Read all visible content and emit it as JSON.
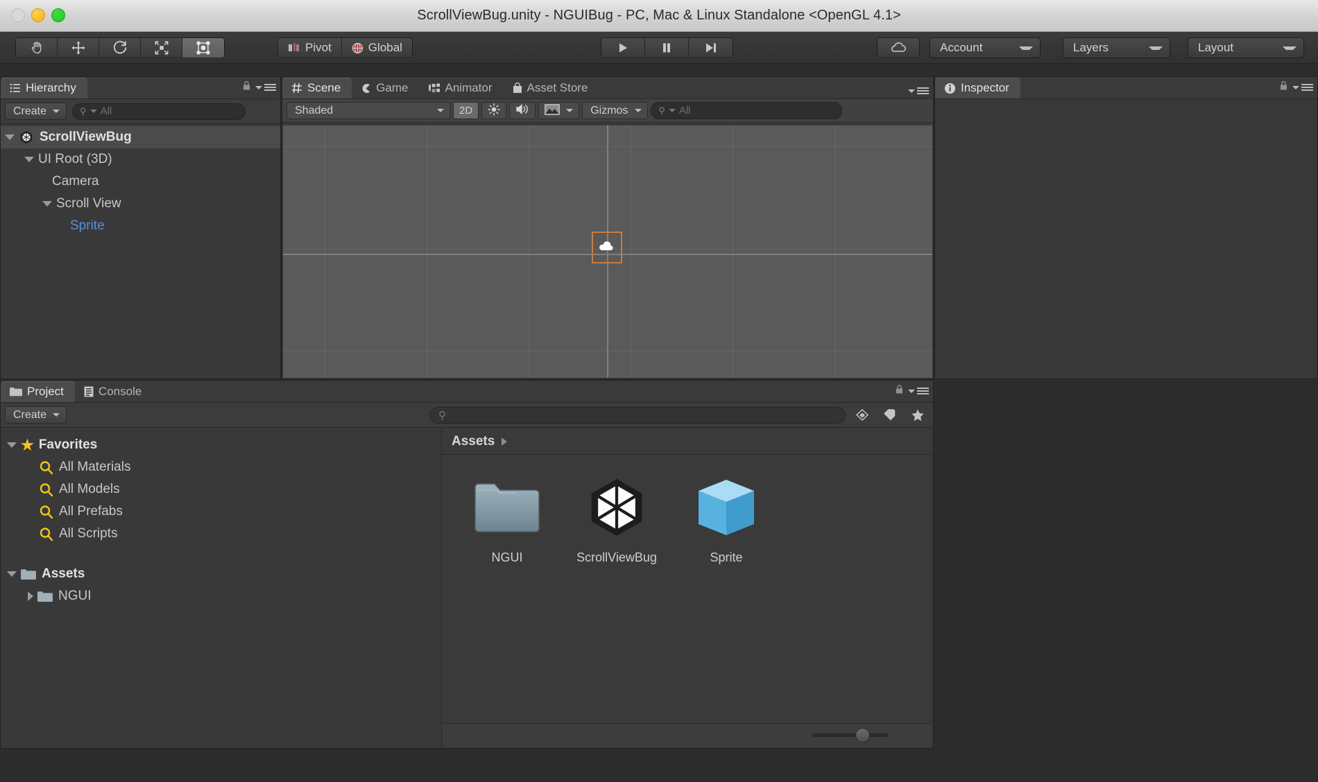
{
  "window": {
    "title": "ScrollViewBug.unity - NGUIBug - PC, Mac & Linux Standalone <OpenGL 4.1>",
    "traffic_lights": [
      "close-button",
      "minimize-button",
      "zoom-button"
    ]
  },
  "toolbar": {
    "transform_tools": [
      {
        "name": "hand-tool",
        "selected": false
      },
      {
        "name": "move-tool",
        "selected": false
      },
      {
        "name": "rotate-tool",
        "selected": false
      },
      {
        "name": "scale-tool",
        "selected": false
      },
      {
        "name": "rect-tool",
        "selected": true
      }
    ],
    "pivot_label": "Pivot",
    "global_label": "Global",
    "play_label": "",
    "pause_label": "",
    "step_label": "",
    "cloud_label": "",
    "account_label": "Account",
    "layers_label": "Layers",
    "layout_label": "Layout"
  },
  "hierarchy": {
    "tab_label": "Hierarchy",
    "create_label": "Create",
    "search_placeholder": "All",
    "items": [
      {
        "label": "ScrollViewBug",
        "depth": 0,
        "arrow": "down",
        "icon": "unity-logo-icon",
        "style": "root",
        "selected": true
      },
      {
        "label": "UI Root (3D)",
        "depth": 1,
        "arrow": "down",
        "icon": "",
        "style": "normal",
        "selected": false
      },
      {
        "label": "Camera",
        "depth": 2,
        "arrow": "none",
        "icon": "",
        "style": "normal",
        "selected": false
      },
      {
        "label": "Scroll View",
        "depth": 2,
        "arrow": "down",
        "icon": "",
        "style": "normal",
        "selected": false
      },
      {
        "label": "Sprite",
        "depth": 3,
        "arrow": "none",
        "icon": "",
        "style": "prefab",
        "selected": false
      }
    ]
  },
  "scene": {
    "tabs": [
      {
        "label": "Scene",
        "icon": "scene-grid-icon",
        "active": true
      },
      {
        "label": "Game",
        "icon": "game-pacman-icon",
        "active": false
      },
      {
        "label": "Animator",
        "icon": "animator-icon",
        "active": false
      },
      {
        "label": "Asset Store",
        "icon": "asset-store-icon",
        "active": false
      }
    ],
    "shading_mode": "Shaded",
    "toggle_2d": "2D",
    "lighting_icon": "sunlight-icon",
    "audio_icon": "audio-icon",
    "effects_icon": "effects-image-icon",
    "gizmos_label": "Gizmos",
    "search_placeholder": "All",
    "selection_object": "Sprite"
  },
  "inspector": {
    "tab_label": "Inspector",
    "icon": "info-icon",
    "empty": true
  },
  "project": {
    "tabs": [
      {
        "label": "Project",
        "icon": "folder-icon",
        "active": true
      },
      {
        "label": "Console",
        "icon": "console-icon",
        "active": false
      }
    ],
    "create_label": "Create",
    "search_placeholder": "",
    "toolbar_icons": [
      "filter-by-type-icon",
      "filter-by-label-icon",
      "favorite-star-icon"
    ],
    "tree": [
      {
        "label": "Favorites",
        "depth": 0,
        "arrow": "down",
        "icon": "star-icon",
        "style": "bold"
      },
      {
        "label": "All Materials",
        "depth": 1,
        "arrow": "none",
        "icon": "search-icon",
        "style": "normal"
      },
      {
        "label": "All Models",
        "depth": 1,
        "arrow": "none",
        "icon": "search-icon",
        "style": "normal"
      },
      {
        "label": "All Prefabs",
        "depth": 1,
        "arrow": "none",
        "icon": "search-icon",
        "style": "normal"
      },
      {
        "label": "All Scripts",
        "depth": 1,
        "arrow": "none",
        "icon": "search-icon",
        "style": "normal"
      },
      {
        "label": "Assets",
        "depth": 0,
        "arrow": "down",
        "icon": "folder-icon",
        "style": "bold"
      },
      {
        "label": "NGUI",
        "depth": 1,
        "arrow": "right",
        "icon": "folder-icon",
        "style": "normal"
      }
    ],
    "breadcrumb": "Assets",
    "assets": [
      {
        "name": "NGUI",
        "icon": "folder-thumb"
      },
      {
        "name": "ScrollViewBug",
        "icon": "unity-scene-thumb"
      },
      {
        "name": "Sprite",
        "icon": "prefab-cube-thumb"
      }
    ],
    "zoom_slider_value": 56
  },
  "colors": {
    "accent_selection": "#c87d43",
    "prefab_blue": "#5b8fd6",
    "favorite_yellow": "#f2c51c",
    "panel_bg": "#383838",
    "viewport_bg": "#5a5a5a"
  }
}
